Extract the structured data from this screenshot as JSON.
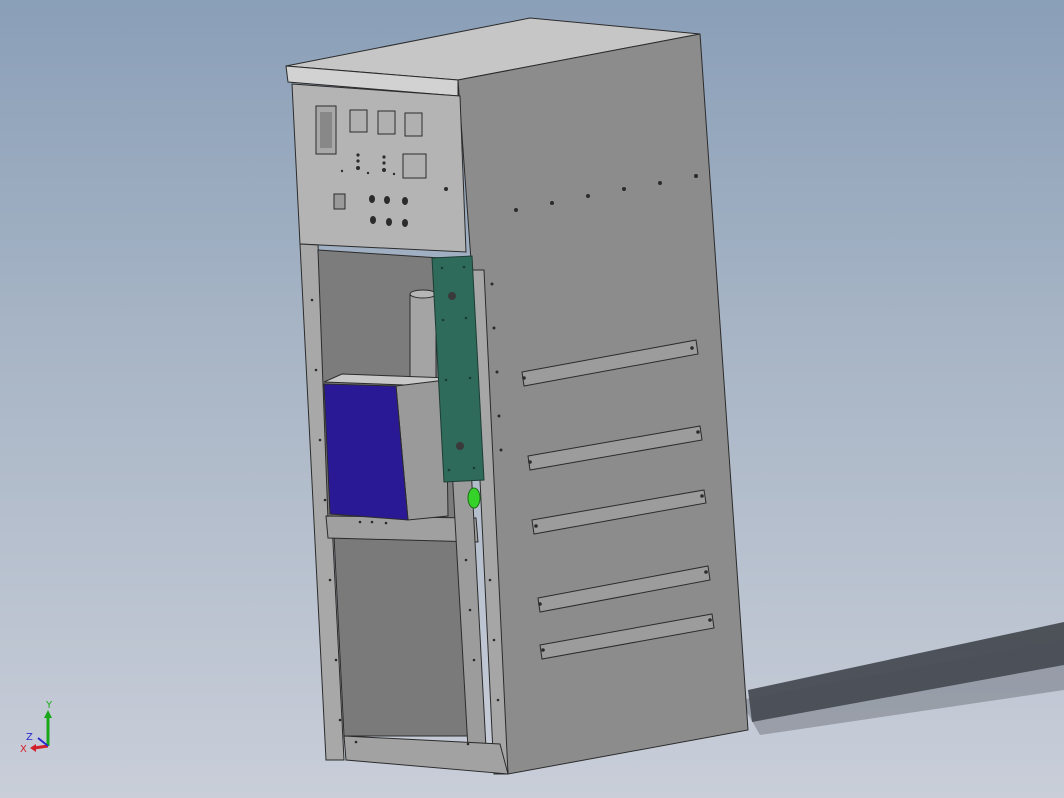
{
  "viewport": {
    "background_top": "#8a9fb8",
    "background_bottom": "#c9ced9"
  },
  "model": {
    "name": "switchgear-cabinet",
    "colors": {
      "side_panel": "#8c8c8c",
      "front_panel": "#b4b4b4",
      "top_panel": "#c6c6c6",
      "interior": "#7c7c7c",
      "blue_box_face": "#2a1994",
      "green_bar": "#2e6b5a",
      "edges": "#2b2b2b"
    }
  },
  "triad": {
    "x_label": "X",
    "y_label": "Y",
    "z_label": "Z",
    "x_color": "#d2202a",
    "y_color": "#1aa81a",
    "z_color": "#2a2ad0"
  }
}
